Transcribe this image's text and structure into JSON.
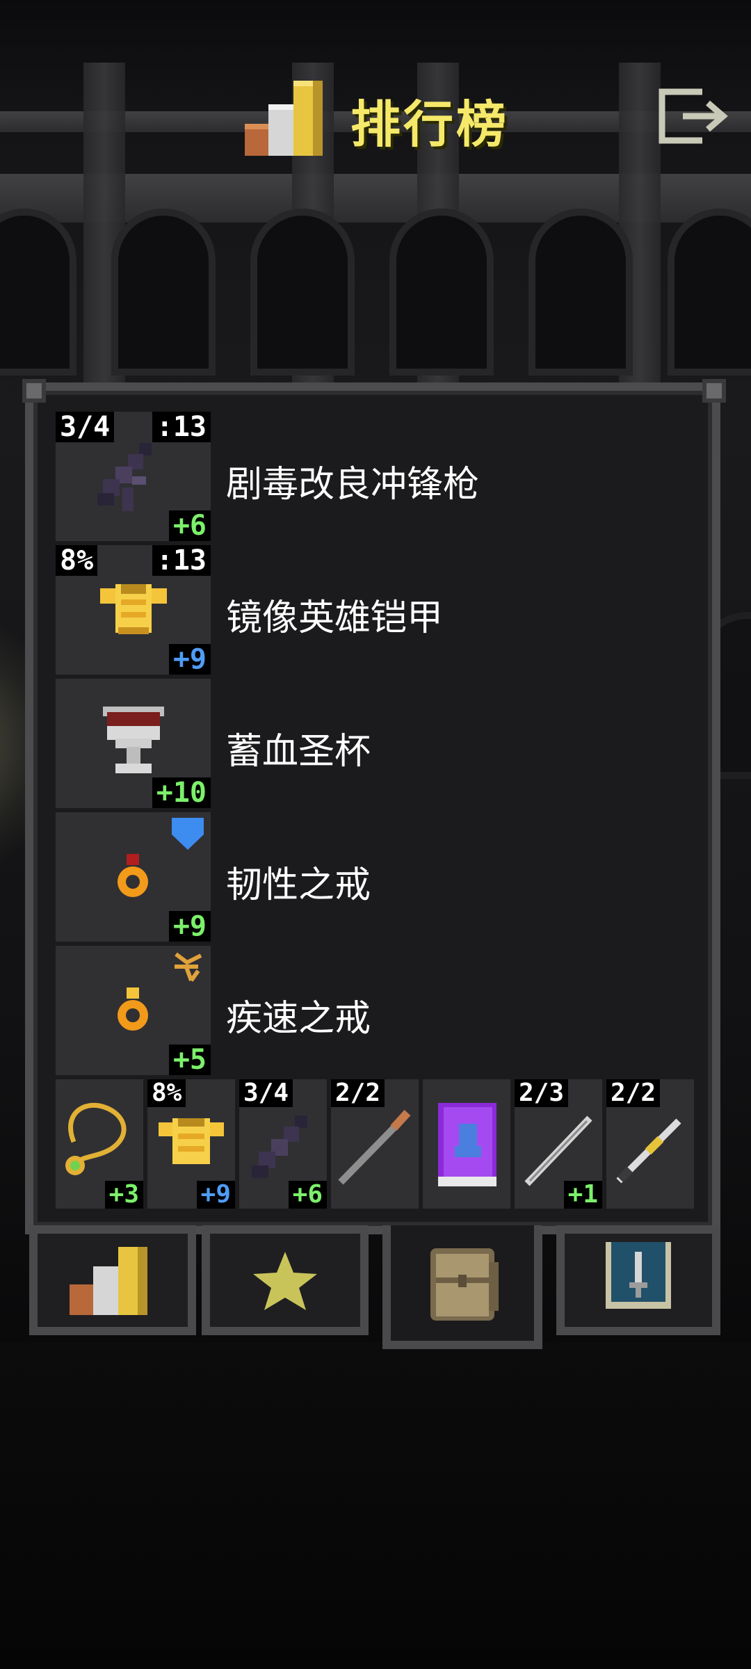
{
  "header": {
    "title": "排行榜",
    "title_color": "#f6e96a",
    "title_icon": "podium-icon",
    "exit_icon": "exit-icon"
  },
  "items": [
    {
      "name": "剧毒改良冲锋枪",
      "icon": "smg-icon",
      "top_left": "3/4",
      "top_right": ":13",
      "level": "+6",
      "level_color": "green"
    },
    {
      "name": "镜像英雄铠甲",
      "icon": "gold-armor-icon",
      "top_left": "8%",
      "top_right": ":13",
      "level": "+9",
      "level_color": "blue"
    },
    {
      "name": "蓄血圣杯",
      "icon": "chalice-icon",
      "top_left": "",
      "top_right": "",
      "level": "+10",
      "level_color": "green"
    },
    {
      "name": "韧性之戒",
      "icon": "ring-icon",
      "top_left": "",
      "top_right": "shield-icon",
      "level": "+9",
      "level_color": "green"
    },
    {
      "name": "疾速之戒",
      "icon": "ring-icon",
      "top_left": "",
      "top_right": "haste-icon",
      "level": "+5",
      "level_color": "green"
    }
  ],
  "quickbar": [
    {
      "icon": "amulet-icon",
      "top_left": "",
      "level": "+3",
      "level_color": "green"
    },
    {
      "icon": "gold-armor-icon",
      "top_left": "8%",
      "level": "+9",
      "level_color": "blue"
    },
    {
      "icon": "smg-icon",
      "top_left": "3/4",
      "level": "+6",
      "level_color": "green"
    },
    {
      "icon": "spear-icon",
      "top_left": "2/2",
      "level": "",
      "level_color": ""
    },
    {
      "icon": "spellbook-icon",
      "top_left": "",
      "level": "",
      "level_color": ""
    },
    {
      "icon": "sword-icon",
      "top_left": "2/3",
      "level": "+1",
      "level_color": "green"
    },
    {
      "icon": "wand-icon",
      "top_left": "2/2",
      "level": "",
      "level_color": ""
    }
  ],
  "tabs": [
    {
      "icon": "podium-icon",
      "active": false
    },
    {
      "icon": "star-icon",
      "active": false
    },
    {
      "icon": "backpack-icon",
      "active": true
    },
    {
      "icon": "sword-badge-icon",
      "active": false
    }
  ]
}
